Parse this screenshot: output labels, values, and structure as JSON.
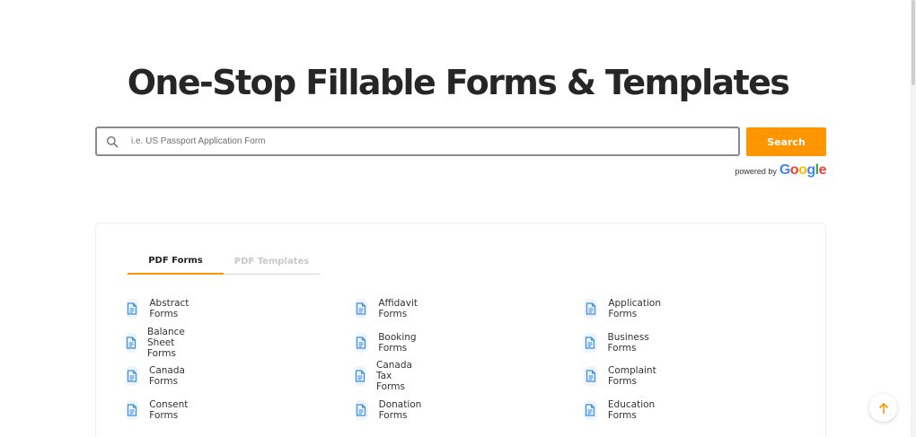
{
  "hero": {
    "title": "One-Stop Fillable Forms & Templates"
  },
  "search": {
    "placeholder": "i.e. US Passport Application Form",
    "button_label": "Search",
    "powered_by": "powered by",
    "google_letters": [
      {
        "char": "G",
        "color": "#4285F4"
      },
      {
        "char": "o",
        "color": "#EA4335"
      },
      {
        "char": "o",
        "color": "#FBBC05"
      },
      {
        "char": "g",
        "color": "#4285F4"
      },
      {
        "char": "l",
        "color": "#34A853"
      },
      {
        "char": "e",
        "color": "#EA4335"
      }
    ]
  },
  "tabs": [
    {
      "label": "PDF Forms",
      "active": true
    },
    {
      "label": "PDF Templates",
      "active": false
    }
  ],
  "forms": {
    "columns": [
      [
        "Abstract Forms",
        "Balance Sheet Forms",
        "Canada Forms",
        "Consent Forms"
      ],
      [
        "Affidavit Forms",
        "Booking Forms",
        "Canada Tax Forms",
        "Donation Forms"
      ],
      [
        "Application Forms",
        "Business Forms",
        "Complaint Forms",
        "Education Forms"
      ]
    ],
    "icon": "document-icon"
  },
  "colors": {
    "accent": "#ff9500",
    "icon_blue": "#3b8de0",
    "icon_bg": "#edf4fc"
  },
  "back_to_top": {
    "icon": "arrow-up-icon"
  }
}
